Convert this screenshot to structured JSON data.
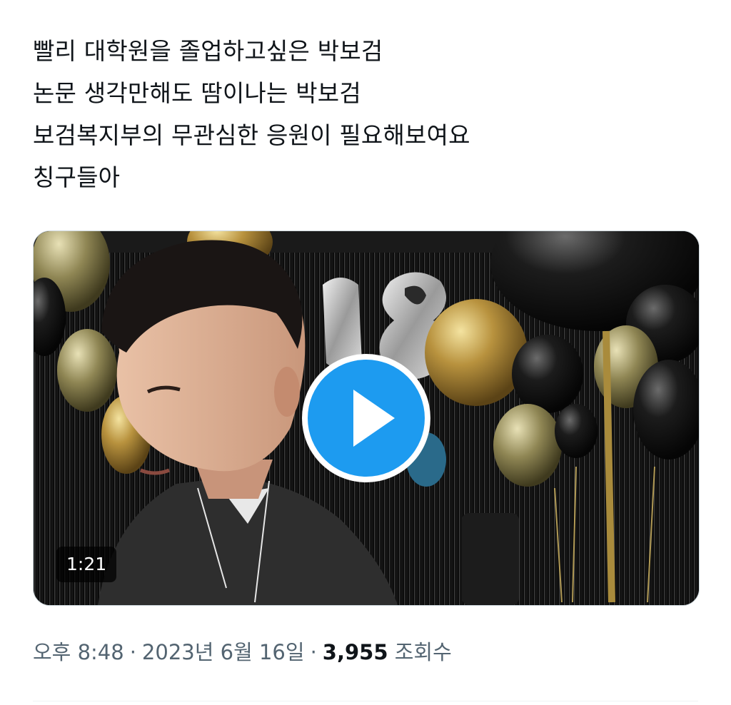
{
  "tweet": {
    "lines": [
      "빨리 대학원을 졸업하고싶은 박보검",
      "논문 생각만해도 땀이나는 박보검",
      "보검복지부의 무관심한 응원이 필요해보여요",
      "칭구들아"
    ]
  },
  "media": {
    "duration": "1:21",
    "play_icon": "play-icon",
    "accent_color": "#1d9bf0"
  },
  "meta": {
    "time": "오후 8:48",
    "separator": "·",
    "date": "2023년 6월 16일",
    "views_count": "3,955",
    "views_label": "조회수"
  },
  "colors": {
    "text_primary": "#0f1419",
    "text_secondary": "#536471",
    "border": "#cfd9de"
  }
}
